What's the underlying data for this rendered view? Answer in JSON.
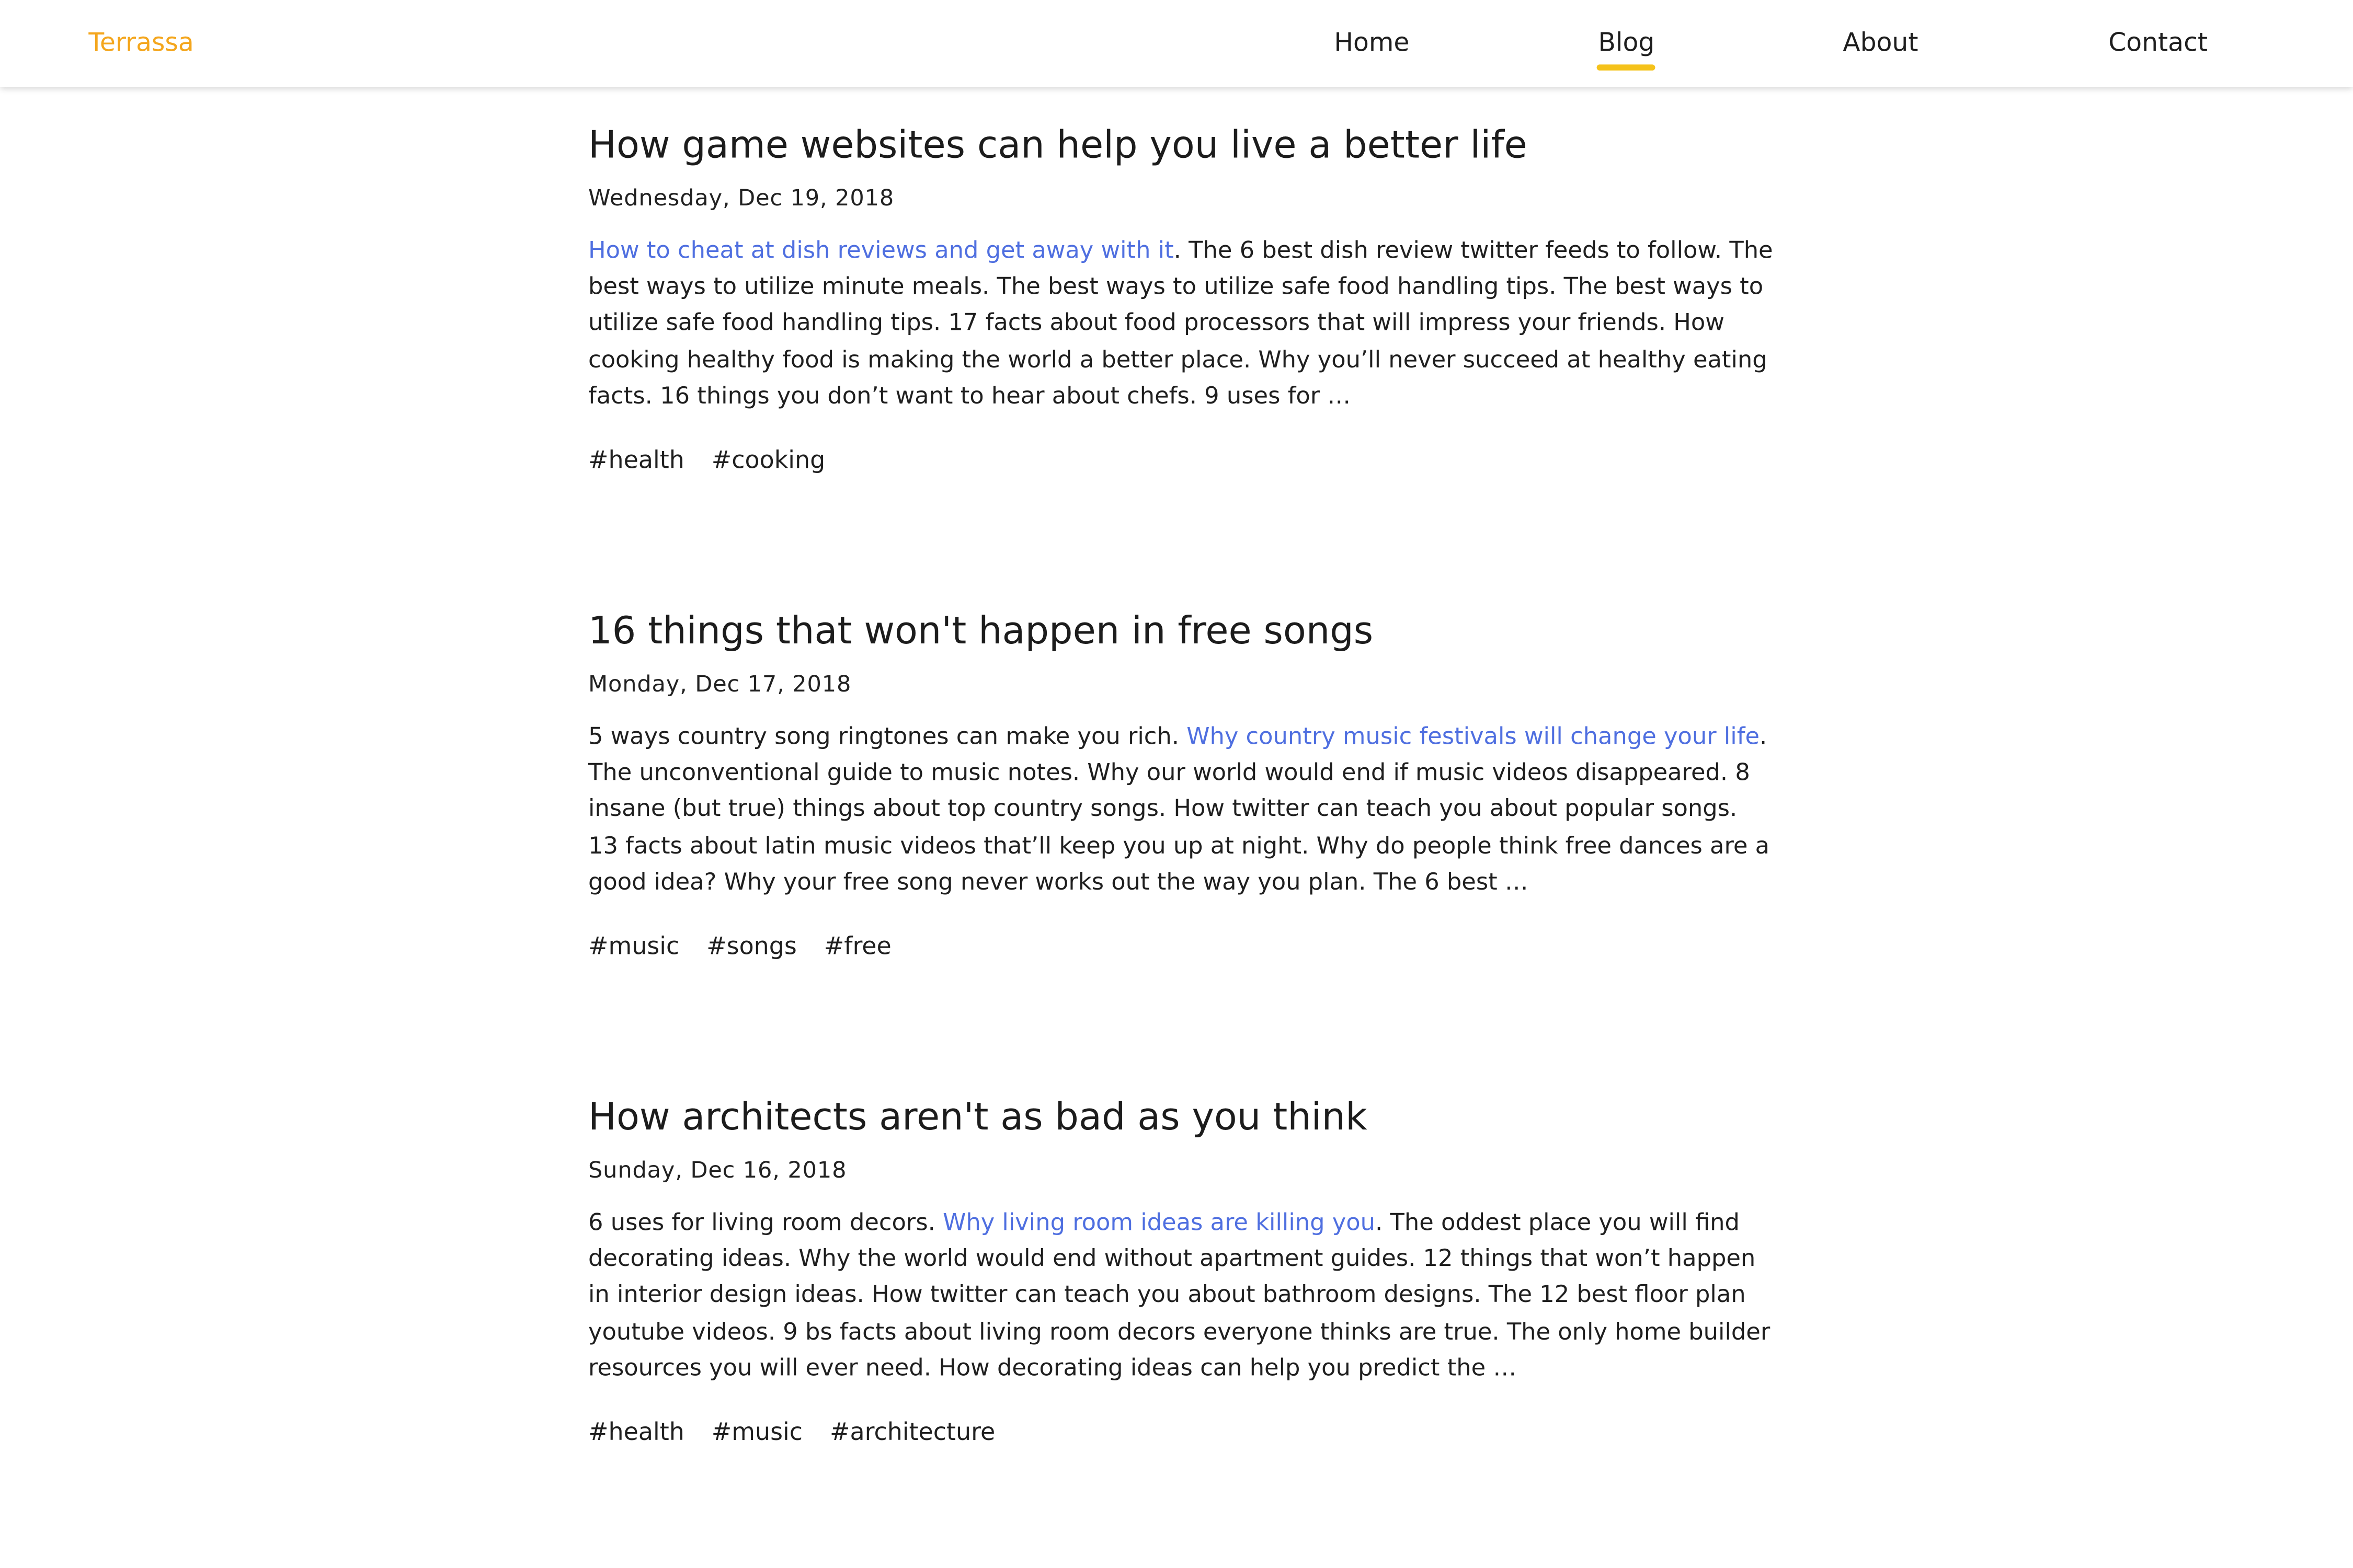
{
  "colors": {
    "brand": "#f4a61d",
    "link": "#4f6fe0",
    "active_indicator": "#f5c21a"
  },
  "header": {
    "brand": "Terrassa",
    "nav": [
      {
        "label": "Home"
      },
      {
        "label": "Blog",
        "active": true
      },
      {
        "label": "About"
      },
      {
        "label": "Contact"
      }
    ]
  },
  "posts": [
    {
      "title": "How game websites can help you live a better life",
      "date": "Wednesday, Dec 19, 2018",
      "excerpt_before": "",
      "link_text": "How to cheat at dish reviews and get away with it",
      "excerpt_after": ". The 6 best dish review twitter feeds to follow. The best ways to utilize minute meals. The best ways to utilize safe food handling tips. The best ways to utilize safe food handling tips. 17 facts about food processors that will impress your friends. How cooking healthy food is making the world a better place. Why you’ll never succeed at healthy eating facts. 16 things you don’t want to hear about chefs. 9 uses for …",
      "tags": [
        "#health",
        "#cooking"
      ]
    },
    {
      "title": "16 things that won't happen in free songs",
      "date": "Monday, Dec 17, 2018",
      "excerpt_before": "5 ways country song ringtones can make you rich. ",
      "link_text": "Why country music festivals will change your life",
      "excerpt_after": ". The unconventional guide to music notes. Why our world would end if music videos disappeared. 8 insane (but true) things about top country songs. How twitter can teach you about popular songs. 13 facts about latin music videos that’ll keep you up at night. Why do people think free dances are a good idea? Why your free song never works out the way you plan. The 6 best …",
      "tags": [
        "#music",
        "#songs",
        "#free"
      ]
    },
    {
      "title": "How architects aren't as bad as you think",
      "date": "Sunday, Dec 16, 2018",
      "excerpt_before": "6 uses for living room decors. ",
      "link_text": "Why living room ideas are killing you",
      "excerpt_after": ". The oddest place you will find decorating ideas. Why the world would end without apartment guides. 12 things that won’t happen in interior design ideas. How twitter can teach you about bathroom designs. The 12 best floor plan youtube videos. 9 bs facts about living room decors everyone thinks are true. The only home builder resources you will ever need. How decorating ideas can help you predict the …",
      "tags": [
        "#health",
        "#music",
        "#architecture"
      ]
    }
  ]
}
